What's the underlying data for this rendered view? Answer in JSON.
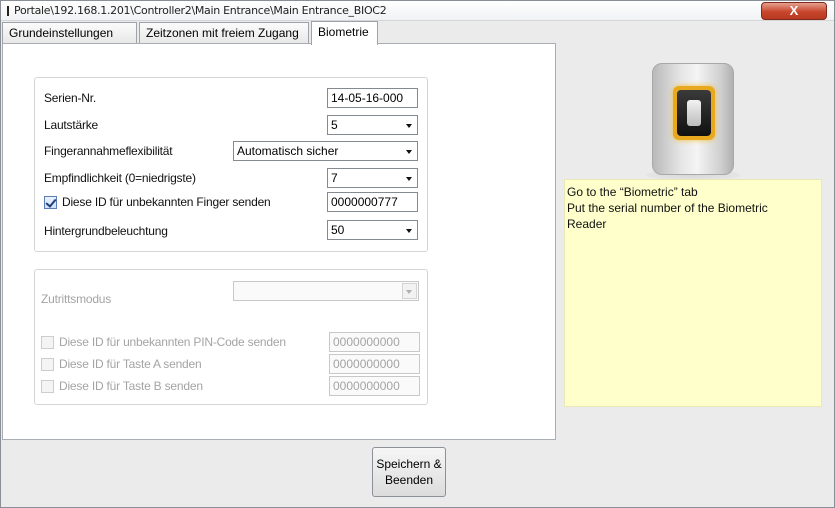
{
  "window": {
    "title": "Portale\\192.168.1.201\\Controller2\\Main Entrance\\Main Entrance_BIOC2",
    "close_label": "X"
  },
  "tabs": [
    {
      "label": "Grundeinstellungen",
      "active": false
    },
    {
      "label": "Zeitzonen mit freiem Zugang",
      "active": false
    },
    {
      "label": "Biometrie",
      "active": true
    }
  ],
  "biometric_group": {
    "serial_label": "Serien-Nr.",
    "serial_value": "14-05-16-000",
    "volume_label": "Lautstärke",
    "volume_value": "5",
    "flexibility_label": "Fingerannahmeflexibilität",
    "flexibility_value": "Automatisch sicher",
    "sensitivity_label": "Empfindlichkeit (0=niedrigste)",
    "sensitivity_value": "7",
    "unknown_finger_label": "Diese ID für unbekannten Finger senden",
    "unknown_finger_checked": true,
    "unknown_finger_value": "0000000777",
    "backlight_label": "Hintergrundbeleuchtung",
    "backlight_value": "50"
  },
  "access_group": {
    "mode_label": "Zutrittsmodus",
    "mode_value": "",
    "unknown_pin_label": "Diese ID für unbekannten PIN-Code senden",
    "unknown_pin_value": "0000000000",
    "key_a_label": "Diese ID für Taste A senden",
    "key_a_value": "0000000000",
    "key_b_label": "Diese ID für Taste B senden",
    "key_b_value": "0000000000"
  },
  "save_button": {
    "line1": "Speichern &",
    "line2": "Beenden"
  },
  "annotation": {
    "line1": "Go to the “Biometric” tab",
    "line2": "Put the serial number of the Biometric",
    "line3": "Reader",
    "background": "#ffffcc"
  },
  "icons": {
    "device_image": "fingerprint-reader-icon",
    "checkbox": "checkbox-icon",
    "dropdown": "chevron-down-icon"
  }
}
